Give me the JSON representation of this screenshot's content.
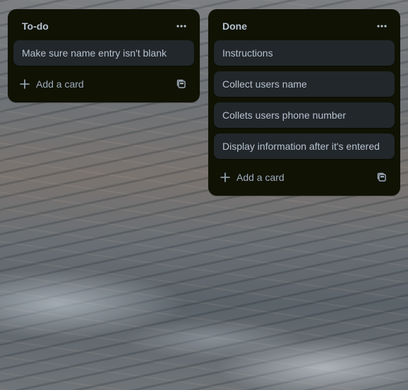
{
  "lists": [
    {
      "title": "To-do",
      "cards": [
        "Make sure name entry isn't blank"
      ],
      "add_card_label": "Add a card"
    },
    {
      "title": "Done",
      "cards": [
        "Instructions",
        "Collect users name",
        "Collets users phone number",
        "Display information after it's entered"
      ],
      "add_card_label": "Add a card"
    }
  ],
  "icons": {
    "more": "more-horizontal-icon",
    "add": "plus-icon",
    "template": "card-template-icon"
  },
  "colors": {
    "list_background": "#101204",
    "card_background": "#22272b",
    "text": "#b6c2cf",
    "muted_text": "#9fadbc"
  }
}
